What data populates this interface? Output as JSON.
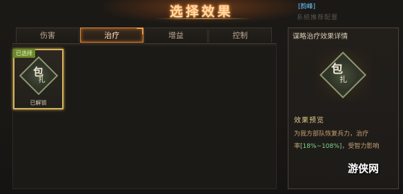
{
  "header": {
    "title": "选择效果",
    "top_badge": "[韵峰]",
    "ghost_subtitle": "系统推荐配置"
  },
  "tabs": [
    {
      "label": "伤害",
      "active": false
    },
    {
      "label": "治疗",
      "active": true
    },
    {
      "label": "增益",
      "active": false
    },
    {
      "label": "控制",
      "active": false
    }
  ],
  "slots": [
    {
      "tag": "已选择",
      "icon_char_1": "包",
      "icon_char_2": "扎",
      "label": "已解锁",
      "icon": "bandage-seal-icon"
    }
  ],
  "detail": {
    "title": "谋略治疗效果详情",
    "icon_char_1": "包",
    "icon_char_2": "扎",
    "preview_heading": "效果预览",
    "preview_line_1": "为我方部队恢复兵力，治疗",
    "preview_rate_prefix": "率",
    "preview_rate": "[18%~108%]",
    "preview_rate_suffix": "，受智力影响"
  },
  "watermark": "游侠网",
  "colors": {
    "accent_orange": "#d98a3e",
    "selected_gold": "#d8b35a",
    "tag_green": "#6a8a2a",
    "highlight_green": "#7fd48a"
  }
}
